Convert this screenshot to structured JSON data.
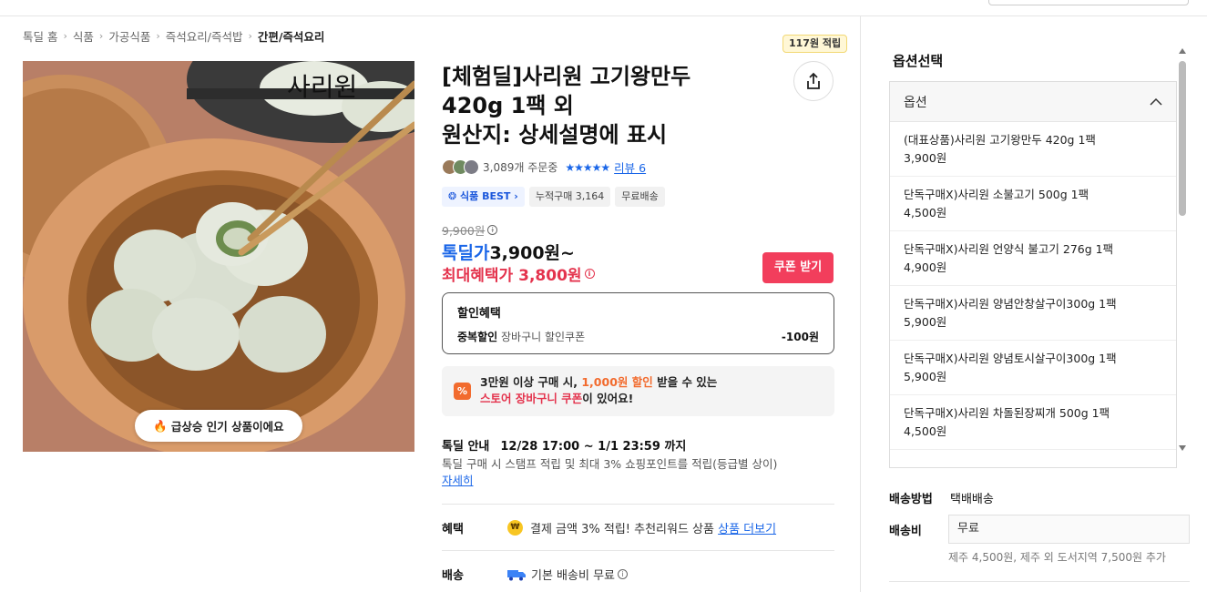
{
  "breadcrumb": [
    "톡딜 홈",
    "식품",
    "가공식품",
    "즉석요리/즉석밥",
    "간편/즉석요리"
  ],
  "product": {
    "title_line1": "[체험딜]사리원 고기왕만두",
    "title_line2": "420g 1팩 외",
    "title_line3": "원산지: 상세설명에 표시",
    "image_logo": "사리원",
    "hot_badge": "급상승 인기 상품이에요",
    "points_badge": "117원 적립"
  },
  "meta": {
    "orders": "3,089개 주문중",
    "stars": "★★★★★",
    "review": "리뷰 6"
  },
  "tags": {
    "best": "식품 BEST",
    "cumulative": "누적구매 3,164",
    "free_ship": "무료배송"
  },
  "price": {
    "original": "9,900원",
    "deal_label": "톡딜가",
    "deal_amount": "3,900원~",
    "max_label": "최대혜택가",
    "max_amount": "3,800원",
    "coupon_button": "쿠폰 받기"
  },
  "discount": {
    "title": "할인혜택",
    "row_label": "중복할인",
    "row_desc": "장바구니 할인쿠폰",
    "row_value": "-100원"
  },
  "promo": {
    "icon": "%",
    "line1_a": "3만원 이상 구매 시, ",
    "line1_b": "1,000원 할인",
    "line1_c": " 받을 수 있는",
    "line2_a": "스토어 장바구니 쿠폰",
    "line2_b": "이 있어요!"
  },
  "sale": {
    "label": "톡딜 안내",
    "period": "12/28 17:00 ~ 1/1 23:59 까지",
    "stamp": "톡딜 구매 시 스탬프 적립 및 최대 3% 쇼핑포인트를 적립(등급별 상이)",
    "more": "자세히"
  },
  "benefit": {
    "label": "혜택",
    "coin": "₩",
    "text": "결제 금액 3% 적립! 추천리워드 상품",
    "link": "상품 더보기"
  },
  "delivery": {
    "label": "배송",
    "text": "기본 배송비 무료"
  },
  "options": {
    "title": "옵션선택",
    "header": "옵션",
    "items": [
      {
        "name": "(대표상품)사리원 고기왕만두 420g 1팩",
        "price": "3,900원"
      },
      {
        "name": "단독구매X)사리원 소불고기 500g 1팩",
        "price": "4,500원"
      },
      {
        "name": "단독구매X)사리원 언양식 불고기 276g 1팩",
        "price": "4,900원"
      },
      {
        "name": "단독구매X)사리원 양념안창살구이300g 1팩",
        "price": "5,900원"
      },
      {
        "name": "단독구매X)사리원 양념토시살구이300g 1팩",
        "price": "5,900원"
      },
      {
        "name": "단독구매X)사리원 차돌된장찌개 500g 1팩",
        "price": "4,500원"
      }
    ]
  },
  "shipping": {
    "method_label": "배송방법",
    "method_value": "택배배송",
    "fee_label": "배송비",
    "fee_value": "무료",
    "note": "제주 4,500원, 제주 외 도서지역 7,500원 추가"
  },
  "colors": {
    "accent_blue": "#1a66e8",
    "accent_red": "#f23e5c",
    "promo_orange": "#f26b2e"
  }
}
